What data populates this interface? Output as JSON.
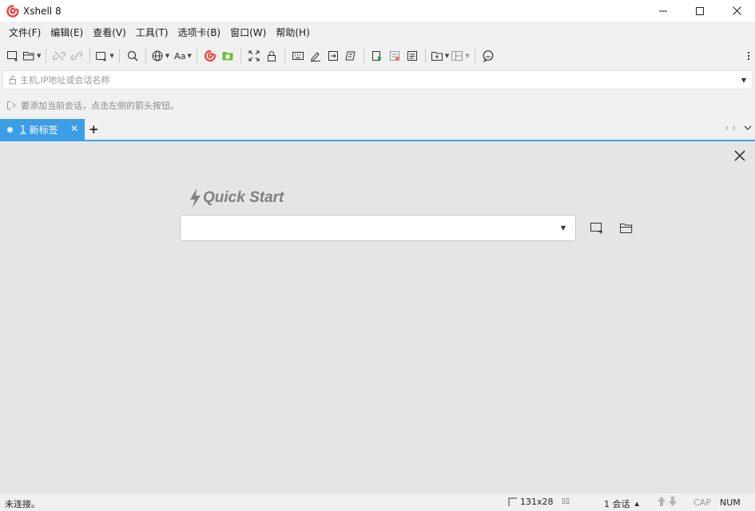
{
  "window": {
    "title": "Xshell 8",
    "brand_color": "#e8453c",
    "controls": [
      "minimize-icon",
      "maximize-icon",
      "close-icon"
    ]
  },
  "menu": [
    {
      "label": "文件(F)"
    },
    {
      "label": "编辑(E)"
    },
    {
      "label": "查看(V)"
    },
    {
      "label": "工具(T)"
    },
    {
      "label": "选项卡(B)"
    },
    {
      "label": "窗口(W)"
    },
    {
      "label": "帮助(H)"
    }
  ],
  "toolbar": {
    "font_button_label": "Aa",
    "icons": [
      "new-session-icon",
      "open-folder-icon",
      "disconnect-icon",
      "reconnect-icon",
      "new-tab-icon",
      "find-icon",
      "globe-icon",
      "font-icon",
      "xshell-icon",
      "xftp-icon",
      "fullscreen-icon",
      "lock-icon",
      "keyboard-icon",
      "compose-icon",
      "transfer-icon",
      "script-icon",
      "log-start-icon",
      "log-icon",
      "notes-icon",
      "add-tab-group-icon",
      "layout-icon",
      "chat-icon",
      "more-icon"
    ]
  },
  "address": {
    "placeholder": "主机,IP地址或会话名称",
    "value": ""
  },
  "session_hint": {
    "text": "要添加当前会话，点击左侧的箭头按钮。"
  },
  "tabs": [
    {
      "number": "1",
      "label": "新标签",
      "active": true
    }
  ],
  "tab_add_label": "+",
  "quick_start": {
    "title": "Quick Start",
    "value": ""
  },
  "status": {
    "connection": "未连接。",
    "size": "131x28",
    "sessions": "1 会话",
    "cap": "CAP",
    "num": "NUM"
  },
  "colors": {
    "accent": "#3c9ee6",
    "workspace": "#e5e5e5",
    "chrome": "#f0f0f0"
  }
}
